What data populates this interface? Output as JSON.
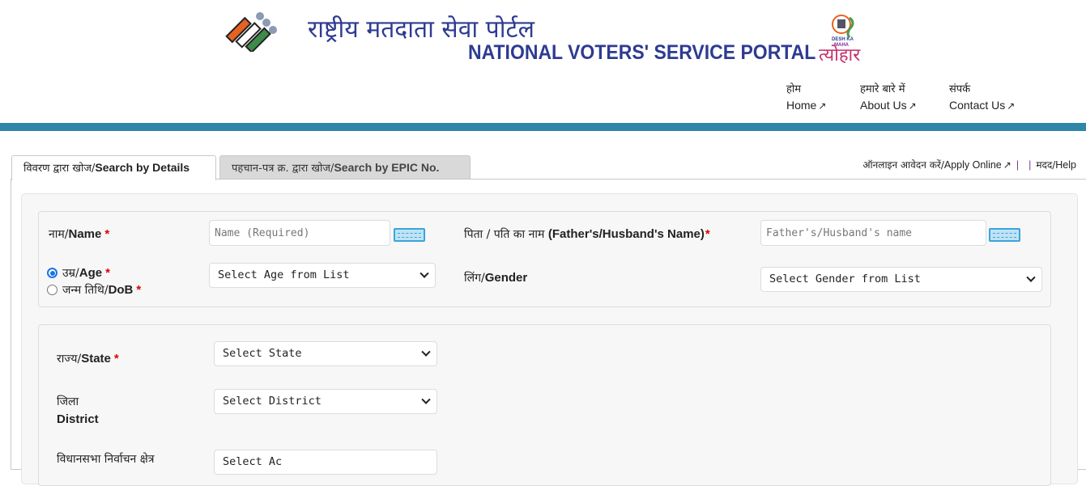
{
  "header": {
    "title_hindi": "राष्ट्रीय मतदाता सेवा पोर्टल",
    "title_english": "NATIONAL VOTERS' SERVICE PORTAL",
    "logos": [
      "eci-logo",
      "desh-ka-maha-tyohar-logo"
    ],
    "tyohar_logo_text": "DESH KA MAHA त्योहार"
  },
  "nav": [
    {
      "hindi": "होम",
      "english": "Home",
      "icon": "external-link-icon"
    },
    {
      "hindi": "हमारे बारे में",
      "english": "About Us",
      "icon": "external-link-icon"
    },
    {
      "hindi": "संपर्क",
      "english": "Contact Us",
      "icon": "external-link-icon"
    }
  ],
  "colors": {
    "brand_blue": "#2d3b92",
    "band": "#2e86a8",
    "required": "#dd0000",
    "keyboard_icon": "#3ba3dc"
  },
  "tabs": [
    {
      "hindi": "विवरण द्वारा खोज/",
      "english": "Search by Details",
      "active": true
    },
    {
      "hindi": "पहचान-पत्र क्र. द्वारा खोज/",
      "english": "Search by EPIC No.",
      "active": false
    }
  ],
  "right_links": {
    "apply_hindi": "ऑनलाइन आवेदन करें/",
    "apply_english": "Apply Online",
    "separator": "|",
    "help_hindi": "मदद/",
    "help_english": "Help"
  },
  "form": {
    "name": {
      "label_hindi": "नाम/",
      "label_english": "Name",
      "required": "*",
      "placeholder": "Name (Required)",
      "value": ""
    },
    "father": {
      "label_hindi": "पिता / पति का नाम ",
      "label_english": "(Father's/Husband's Name)",
      "required": "*",
      "placeholder": "Father's/Husband's name",
      "value": ""
    },
    "age_choice": {
      "age_hindi": "उम्र/",
      "age_english": "Age",
      "age_selected": true,
      "dob_hindi": "जन्म तिथि/",
      "dob_english": "DoB",
      "dob_selected": false,
      "required": "*"
    },
    "age_select": {
      "value": "Select Age from List"
    },
    "gender": {
      "label_hindi": "लिंग/",
      "label_english": "Gender",
      "value": "Select Gender from List"
    },
    "state": {
      "label_hindi": "राज्य/",
      "label_english": "State",
      "required": "*",
      "value": "Select State"
    },
    "district": {
      "label_hindi": "जिला",
      "label_english": "District",
      "value": "Select District"
    },
    "constituency": {
      "label_hindi": "विधानसभा निर्वाचन क्षेत्र",
      "value": "Select Ac"
    }
  }
}
